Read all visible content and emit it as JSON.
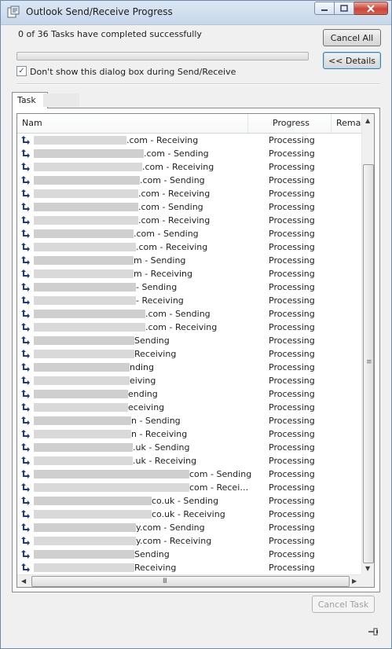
{
  "window": {
    "title": "Outlook Send/Receive Progress"
  },
  "status": {
    "summary": "0 of 36 Tasks have completed successfully",
    "progress": 0
  },
  "buttons": {
    "cancel_all": "Cancel All",
    "details": "<< Details",
    "cancel_task": "Cancel Task"
  },
  "checkbox": {
    "label": "Don't show this dialog box during Send/Receive",
    "checked": true,
    "mark": "✓"
  },
  "tab": {
    "label": "Task"
  },
  "columns": {
    "name": "Nam",
    "progress": "Progress",
    "remaining": "Remai"
  },
  "scroll": {
    "up": "▲",
    "down": "▼",
    "left": "◀",
    "right": "▶",
    "grip": "III"
  },
  "rows": [
    {
      "task": ".com - Receiving",
      "progress": "Processing"
    },
    {
      "task": ".com - Sending",
      "progress": "Processing"
    },
    {
      "task": ".com - Receiving",
      "progress": "Processing"
    },
    {
      "task": ".com - Sending",
      "progress": "Processing"
    },
    {
      "task": ".com - Receiving",
      "progress": "Processing"
    },
    {
      "task": ".com - Sending",
      "progress": "Processing"
    },
    {
      "task": ".com - Receiving",
      "progress": "Processing"
    },
    {
      "task": ".com - Sending",
      "progress": "Processing"
    },
    {
      "task": ".com - Receiving",
      "progress": "Processing"
    },
    {
      "task": "m - Sending",
      "progress": "Processing"
    },
    {
      "task": "m - Receiving",
      "progress": "Processing"
    },
    {
      "task": "- Sending",
      "progress": "Processing"
    },
    {
      "task": "- Receiving",
      "progress": "Processing"
    },
    {
      "task": ".com - Sending",
      "progress": "Processing"
    },
    {
      "task": ".com - Receiving",
      "progress": "Processing"
    },
    {
      "task": "Sending",
      "progress": "Processing"
    },
    {
      "task": "Receiving",
      "progress": "Processing"
    },
    {
      "task": "nding",
      "progress": "Processing"
    },
    {
      "task": "eiving",
      "progress": "Processing"
    },
    {
      "task": "ending",
      "progress": "Processing"
    },
    {
      "task": "eceiving",
      "progress": "Processing"
    },
    {
      "task": "n - Sending",
      "progress": "Processing"
    },
    {
      "task": "n - Receiving",
      "progress": "Processing"
    },
    {
      "task": ".uk - Sending",
      "progress": "Processing"
    },
    {
      "task": ".uk - Receiving",
      "progress": "Processing"
    },
    {
      "task": "com - Sending",
      "progress": "Processing"
    },
    {
      "task": "com - Recei…",
      "progress": "Processing"
    },
    {
      "task": "co.uk - Sending",
      "progress": "Processing"
    },
    {
      "task": "co.uk - Receiving",
      "progress": "Processing"
    },
    {
      "task": "y.com - Sending",
      "progress": "Processing"
    },
    {
      "task": "y.com - Receiving",
      "progress": "Processing"
    },
    {
      "task": "Sending",
      "progress": "Processing"
    },
    {
      "task": "Receiving",
      "progress": "Processing"
    }
  ]
}
